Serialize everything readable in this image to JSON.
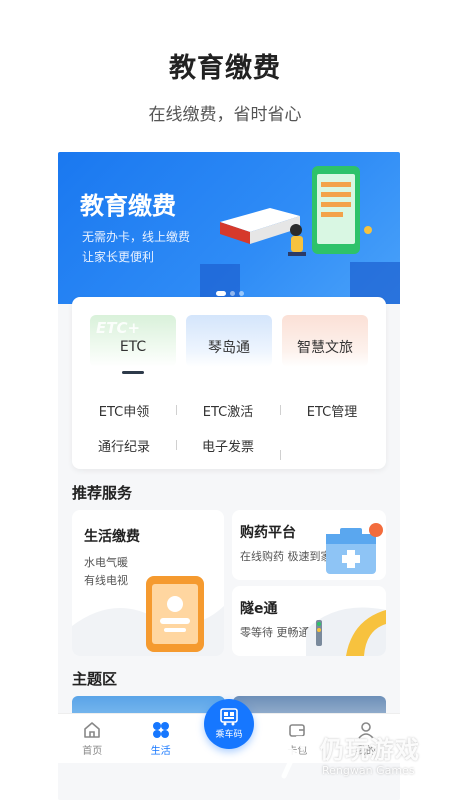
{
  "promo": {
    "headline": "教育缴费",
    "subline": "在线缴费，省时省心"
  },
  "banner": {
    "title": "教育缴费",
    "line1": "无需办卡，线上缴费",
    "line2": "让家长更便利",
    "page_count": 3,
    "active_page": 1,
    "colors": {
      "primary": "#1a78f0",
      "accent": "#4aa2fa"
    }
  },
  "top_tabs": [
    {
      "label": "ETC",
      "watermark": "ETC+",
      "selected": true
    },
    {
      "label": "琴岛通",
      "selected": false
    },
    {
      "label": "智慧文旅",
      "selected": false
    }
  ],
  "etc_grid": [
    [
      "ETC申领",
      "ETC激活",
      "ETC管理"
    ],
    [
      "通行纪录",
      "电子发票"
    ]
  ],
  "recommended": {
    "title": "推荐服务",
    "big": {
      "title": "生活缴费",
      "desc1": "水电气暖",
      "desc2": "有线电视"
    },
    "small": [
      {
        "title": "购药平台",
        "desc": "在线购药 极速到家"
      },
      {
        "title": "隧e通",
        "desc": "零等待 更畅通"
      }
    ]
  },
  "theme": {
    "title": "主题区"
  },
  "tabbar": {
    "items": [
      {
        "label": "首页",
        "icon": "home-icon",
        "active": false
      },
      {
        "label": "生活",
        "icon": "grid-clover-icon",
        "active": true
      },
      {
        "label": "卡包",
        "icon": "wallet-icon",
        "active": false
      },
      {
        "label": "我的",
        "icon": "user-icon",
        "active": false
      }
    ],
    "center": {
      "label": "乘车码",
      "icon": "qr-bus-icon"
    },
    "colors": {
      "active": "#1677ff",
      "inactive": "#888888"
    }
  },
  "watermark": {
    "cn": "仍玩游戏",
    "en": "Rengwan Games"
  }
}
